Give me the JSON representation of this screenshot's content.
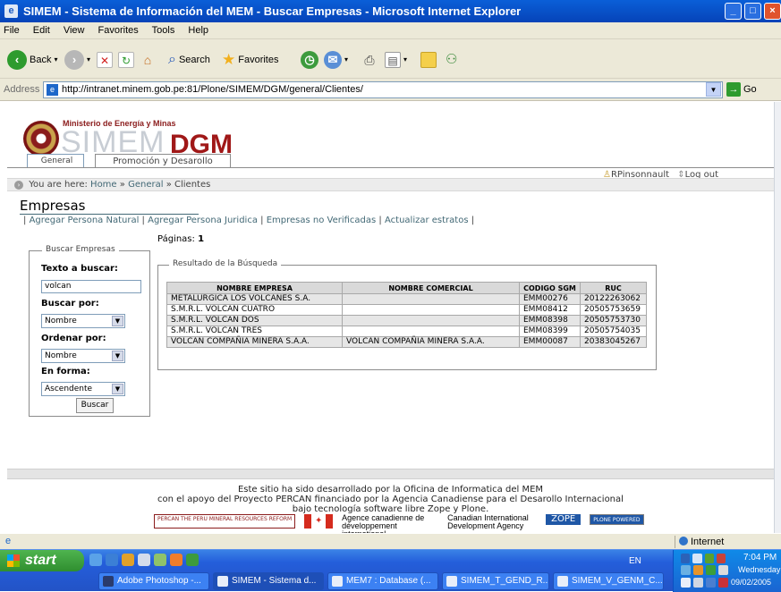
{
  "window": {
    "title": "SIMEM - Sistema de Información del MEM - Buscar Empresas - Microsoft Internet Explorer",
    "controls": [
      "minimize",
      "maximize",
      "close"
    ]
  },
  "menu": {
    "items": [
      "File",
      "Edit",
      "View",
      "Favorites",
      "Tools",
      "Help"
    ]
  },
  "toolbar": {
    "back": "Back",
    "search": "Search",
    "favorites": "Favorites"
  },
  "address": {
    "label": "Address",
    "url": "http://intranet.minem.gob.pe:81/Plone/SIMEM/DGM/general/Clientes/",
    "go": "Go"
  },
  "site": {
    "ministerio": "Ministerio de Energía y Minas",
    "brand_main": "SIMEM",
    "brand_sub": "DGM",
    "tabs": [
      "General",
      "Promoción y Desarollo"
    ],
    "user": "RPinsonnault",
    "logout": "Log out",
    "breadcrumb": {
      "prefix": "You are here:",
      "home": "Home",
      "section": "General",
      "current": "Clientes",
      "sep": "»"
    }
  },
  "page": {
    "heading": "Empresas",
    "actions": [
      "Agregar Persona Natural",
      "Agregar Persona Juridica",
      "Empresas no Verificadas",
      "Actualizar estratos"
    ],
    "paginas_label": "Páginas:",
    "paginas_value": "1"
  },
  "search": {
    "legend": "Buscar Empresas",
    "texto_label": "Texto a buscar:",
    "texto_value": "volcan",
    "buscar_por_label": "Buscar por:",
    "buscar_por_value": "Nombre",
    "ordenar_label": "Ordenar por:",
    "ordenar_value": "Nombre",
    "forma_label": "En forma:",
    "forma_value": "Ascendente",
    "button": "Buscar"
  },
  "results": {
    "legend": "Resultado de la Búsqueda",
    "headers": [
      "NOMBRE EMPRESA",
      "NOMBRE COMERCIAL",
      "CODIGO SGM",
      "RUC"
    ],
    "rows": [
      [
        "METALURGICA LOS VOLCANES S.A.",
        "",
        "EMM00276",
        "20122263062"
      ],
      [
        "S.M.R.L. VOLCAN CUATRO",
        "",
        "EMM08412",
        "20505753659"
      ],
      [
        "S.M.R.L. VOLCAN DOS",
        "",
        "EMM08398",
        "20505753730"
      ],
      [
        "S.M.R.L. VOLCAN TRES",
        "",
        "EMM08399",
        "20505754035"
      ],
      [
        "VOLCAN COMPAÑIA MINERA S.A.A.",
        "VOLCAN COMPAÑIA MINERA S.A.A.",
        "EMM00087",
        "20383045267"
      ]
    ]
  },
  "footer": {
    "line1": "Este sitio ha sido desarrollado por la Oficina de Informatica del MEM",
    "line2": "con el apoyo del Proyecto PERCAN financiado por la Agencia Canadiense para el Desarollo Internacional",
    "line3": "bajo tecnología software libre Zope y Plone.",
    "percan": "THE PERU MINERAL RESOURCES REFORM",
    "percan_tag": "PERCAN",
    "agency_fr": "Agence canadienne de développement international",
    "agency_en": "Canadian International Development Agency",
    "zope": "ZOPE",
    "plone": "PLONE POWERED"
  },
  "status": {
    "zone": "Internet"
  },
  "taskbar": {
    "start": "start",
    "tasks": [
      "Adobe Photoshop -...",
      "SIMEM - Sistema d...",
      "MEM7 : Database (...",
      "SIMEM_T_GEND_R...",
      "SIMEM_V_GENM_C..."
    ],
    "lang": "EN",
    "time": "7:04 PM",
    "weekday": "Wednesday",
    "date": "09/02/2005"
  }
}
